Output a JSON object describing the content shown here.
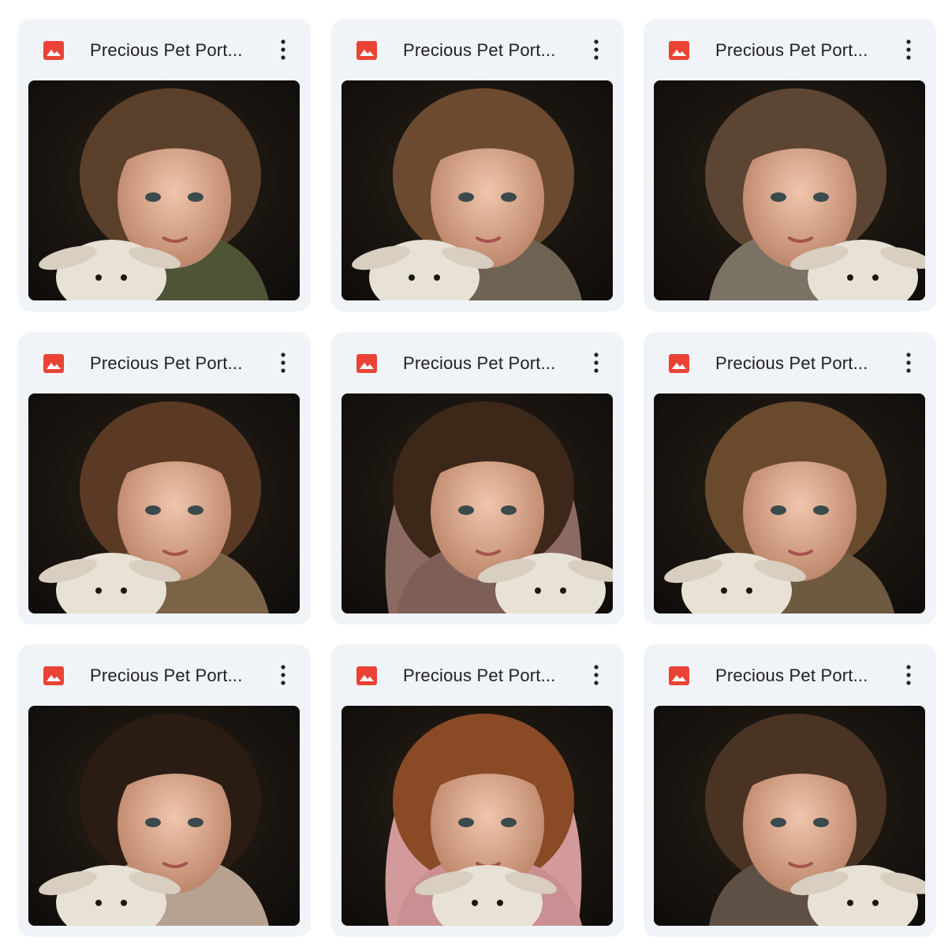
{
  "files": [
    {
      "name": "Precious Pet Port...",
      "icon": "image-file-icon",
      "thumbnail": {
        "hair": "#5a3f2a",
        "clothing": "#4f5436",
        "lamb_side": "left",
        "hood": ""
      }
    },
    {
      "name": "Precious Pet Port...",
      "icon": "image-file-icon",
      "thumbnail": {
        "hair": "#6b4a30",
        "clothing": "#6e6352",
        "lamb_side": "left",
        "hood": ""
      }
    },
    {
      "name": "Precious Pet Port...",
      "icon": "image-file-icon",
      "thumbnail": {
        "hair": "#5c4532",
        "clothing": "#7a7263",
        "lamb_side": "right",
        "hood": ""
      }
    },
    {
      "name": "Precious Pet Port...",
      "icon": "image-file-icon",
      "thumbnail": {
        "hair": "#5a3a24",
        "clothing": "#7b6347",
        "lamb_side": "left",
        "hood": ""
      }
    },
    {
      "name": "Precious Pet Port...",
      "icon": "image-file-icon",
      "thumbnail": {
        "hair": "#3d2719",
        "clothing": "#7d5f58",
        "lamb_side": "right",
        "hood": "#8b6a62"
      }
    },
    {
      "name": "Precious Pet Port...",
      "icon": "image-file-icon",
      "thumbnail": {
        "hair": "#6a4a2c",
        "clothing": "#6e5a41",
        "lamb_side": "left",
        "hood": ""
      }
    },
    {
      "name": "Precious Pet Port...",
      "icon": "image-file-icon",
      "thumbnail": {
        "hair": "#2b1c13",
        "clothing": "#b7a292",
        "lamb_side": "left",
        "hood": ""
      }
    },
    {
      "name": "Precious Pet Port...",
      "icon": "image-file-icon",
      "thumbnail": {
        "hair": "#8a4a26",
        "clothing": "#c98f92",
        "lamb_side": "center",
        "hood": "#d29a9a"
      }
    },
    {
      "name": "Precious Pet Port...",
      "icon": "image-file-icon",
      "thumbnail": {
        "hair": "#4a3322",
        "clothing": "#5e5044",
        "lamb_side": "right",
        "hood": ""
      }
    }
  ],
  "colors": {
    "card_background": "#f0f4f9",
    "image_icon": "#ea4335",
    "title_text": "#1f1f1f",
    "thumbnail_background": "#0e0b09",
    "skin": "#e7b9a0",
    "lamb": "#e8e2d6"
  }
}
